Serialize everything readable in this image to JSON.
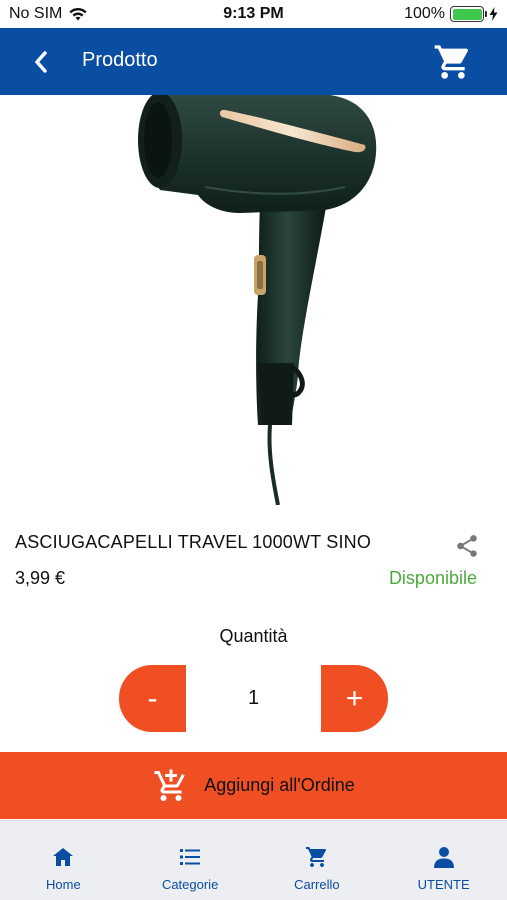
{
  "status_bar": {
    "carrier": "No SIM",
    "time": "9:13 PM",
    "battery": "100%"
  },
  "header": {
    "title": "Prodotto",
    "color": "#0a4ea4"
  },
  "product": {
    "image_subject": "hair-dryer",
    "name": "ASCIUGACAPELLI TRAVEL 1000WT SINO",
    "price": "3,99 €",
    "availability": "Disponibile",
    "availability_color": "#4caa3c"
  },
  "quantity": {
    "label": "Quantità",
    "value": "1",
    "minus_label": "-",
    "plus_label": "+"
  },
  "add_to_order": {
    "label": "Aggiungi all'Ordine",
    "color": "#f04e23"
  },
  "tabs": [
    {
      "label": "Home",
      "icon": "home-icon"
    },
    {
      "label": "Categorie",
      "icon": "list-icon"
    },
    {
      "label": "Carrello",
      "icon": "cart-icon"
    },
    {
      "label": "UTENTE",
      "icon": "user-icon"
    }
  ]
}
